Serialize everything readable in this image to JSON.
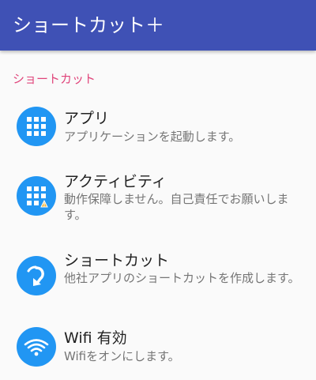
{
  "appbar": {
    "title": "ショートカット＋",
    "color": "#3f51b5"
  },
  "section": {
    "header": "ショートカット",
    "header_color": "#e0457b"
  },
  "items": [
    {
      "title": "アプリ",
      "summary": "アプリケーションを起動します。",
      "icon": "apps-grid-icon"
    },
    {
      "title": "アクティビティ",
      "summary": "動作保障しません。自己責任でお願いします。",
      "icon": "apps-grid-warning-icon"
    },
    {
      "title": "ショートカット",
      "summary": "他社アプリのショートカットを作成します。",
      "icon": "shortcut-arrow-icon"
    },
    {
      "title": "Wifi 有効",
      "summary": "Wifiをオンにします。",
      "icon": "wifi-icon"
    }
  ],
  "icon_color": "#2196f3"
}
